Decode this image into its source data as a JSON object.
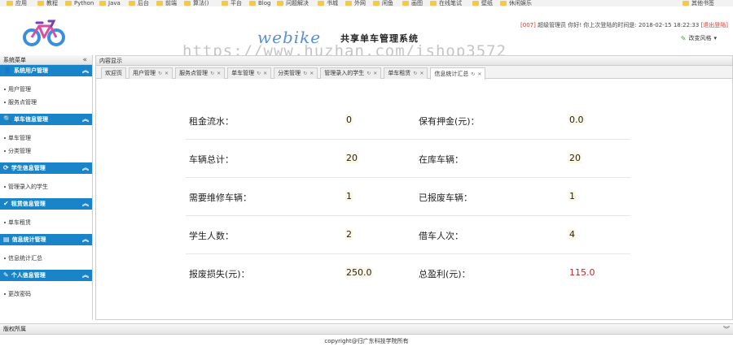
{
  "bookmarks": [
    "应用",
    "教程",
    "Python",
    "Java",
    "后台",
    "前端",
    "算法()",
    "平台",
    "Blog",
    "问题解决",
    "书城",
    "外网",
    "闲鱼",
    "画图",
    "在线笔试",
    "壁纸",
    "休闲娱乐",
    "其他书签"
  ],
  "header": {
    "brand": "webike",
    "brand_sub": "共享单车管理系统",
    "user_id": "[007]",
    "user_text": "超级管理员 你好! 你上次登陆的时间是: 2018-02-15 18:22:33",
    "logout": "[退出登陆]",
    "theme_button": "改变风格",
    "watermark": "https://www.huzhan.com/ishop3572"
  },
  "sidebar": {
    "title": "系统菜单",
    "collapse": "«",
    "groups": [
      {
        "title": "系统用户管理",
        "icon": "👤",
        "items": [
          "用户管理",
          "服务点管理"
        ]
      },
      {
        "title": "单车信息管理",
        "icon": "🔍",
        "items": [
          "单车管理",
          "分类管理"
        ]
      },
      {
        "title": "学生信息管理",
        "icon": "⟳",
        "items": [
          "管理录入的学生"
        ]
      },
      {
        "title": "租赁信息管理",
        "icon": "✔",
        "items": [
          "单车租赁"
        ]
      },
      {
        "title": "信息统计管理",
        "icon": "▤",
        "items": [
          "信息统计汇总"
        ]
      },
      {
        "title": "个人信息管理",
        "icon": "✎",
        "items": [
          "更改密码"
        ]
      }
    ]
  },
  "main": {
    "title": "内容显示",
    "tabs": [
      "欢迎页",
      "用户管理",
      "服务点管理",
      "单车管理",
      "分类管理",
      "管理录入的学生",
      "单车租赁",
      "信息统计汇总"
    ],
    "stats": [
      {
        "label1": "租金流水：",
        "value1": "0",
        "label2": "保有押金(元)：",
        "value2": "0.0"
      },
      {
        "label1": "车辆总计：",
        "value1": "20",
        "label2": "在库车辆：",
        "value2": "20"
      },
      {
        "label1": "需要维修车辆：",
        "value1": "1",
        "label2": "已报废车辆：",
        "value2": "1"
      },
      {
        "label1": "学生人数：",
        "value1": "2",
        "label2": "借车人次：",
        "value2": "4"
      },
      {
        "label1": "报废损失(元)：",
        "value1": "250.0",
        "label2": "总盈利(元)：",
        "value2": "115.0"
      }
    ],
    "accent": "#1a84c8",
    "profit_color": "#c0222b"
  },
  "footer": {
    "title": "版权所属",
    "copyright": "copyright@归广东科技学院所有"
  }
}
